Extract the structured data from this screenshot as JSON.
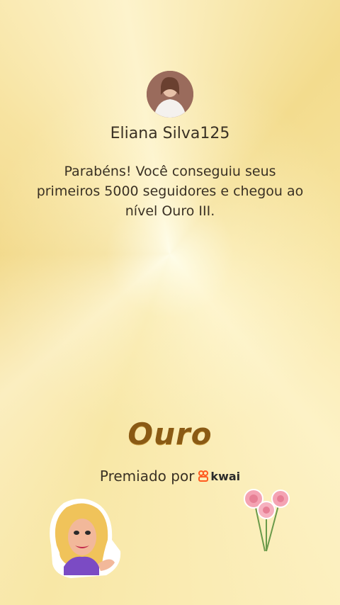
{
  "profile": {
    "username": "Eliana Silva125"
  },
  "message": "Parabéns! Você conseguiu seus primeiros 5000 seguidores e chegou ao nível Ouro III.",
  "level": {
    "name": "Ouro"
  },
  "awarded": {
    "label": "Premiado por",
    "brand": "kwai",
    "brand_icon": "kwai-logo-icon"
  },
  "stickers": {
    "left": "woman-sticker",
    "right": "roses-sticker"
  },
  "colors": {
    "background": "#f8e7a6",
    "level_text": "#8a5a14",
    "brand_accent": "#ff5a1f",
    "body_text": "#3a3124"
  }
}
